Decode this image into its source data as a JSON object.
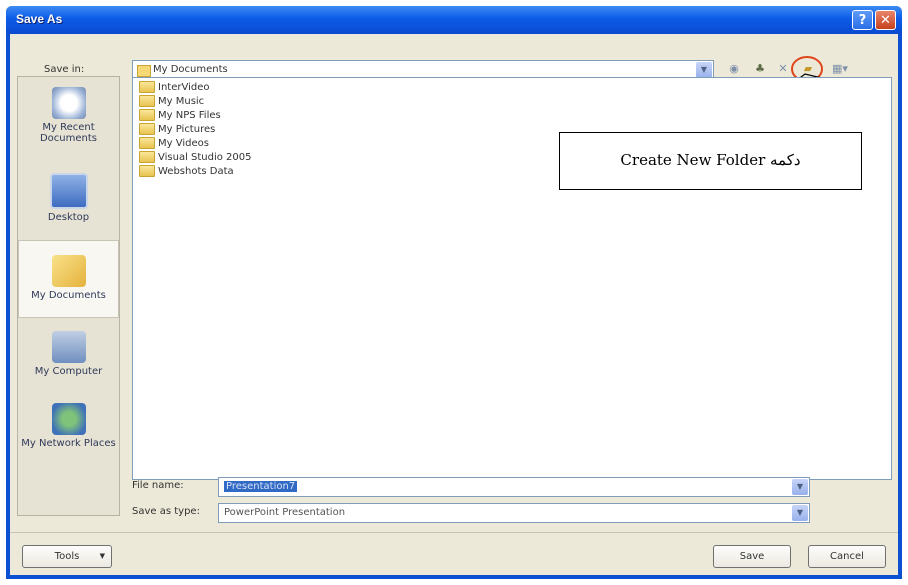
{
  "dialog": {
    "title": "Save As"
  },
  "titlebar": {
    "help_label": "?",
    "close_label": "✕"
  },
  "save_in": {
    "label": "Save in:",
    "value": "My Documents"
  },
  "places": [
    {
      "label": "My Recent Documents"
    },
    {
      "label": "Desktop"
    },
    {
      "label": "My Documents"
    },
    {
      "label": "My Computer"
    },
    {
      "label": "My Network Places"
    }
  ],
  "files": [
    {
      "name": "InterVideo"
    },
    {
      "name": "My Music"
    },
    {
      "name": "My NPS Files"
    },
    {
      "name": "My Pictures"
    },
    {
      "name": "My Videos"
    },
    {
      "name": "Visual Studio 2005"
    },
    {
      "name": "Webshots Data"
    }
  ],
  "file_name": {
    "label": "File name:",
    "value": "Presentation7"
  },
  "save_as_type": {
    "label": "Save as type:",
    "value": "PowerPoint Presentation"
  },
  "buttons": {
    "tools": "Tools",
    "save": "Save",
    "cancel": "Cancel"
  },
  "annotation": {
    "text": "Create New Folder دکمه"
  },
  "colors": {
    "titlebar": "#0a4bd0",
    "client": "#ece9d8",
    "highlight_circle": "#e0461b"
  }
}
